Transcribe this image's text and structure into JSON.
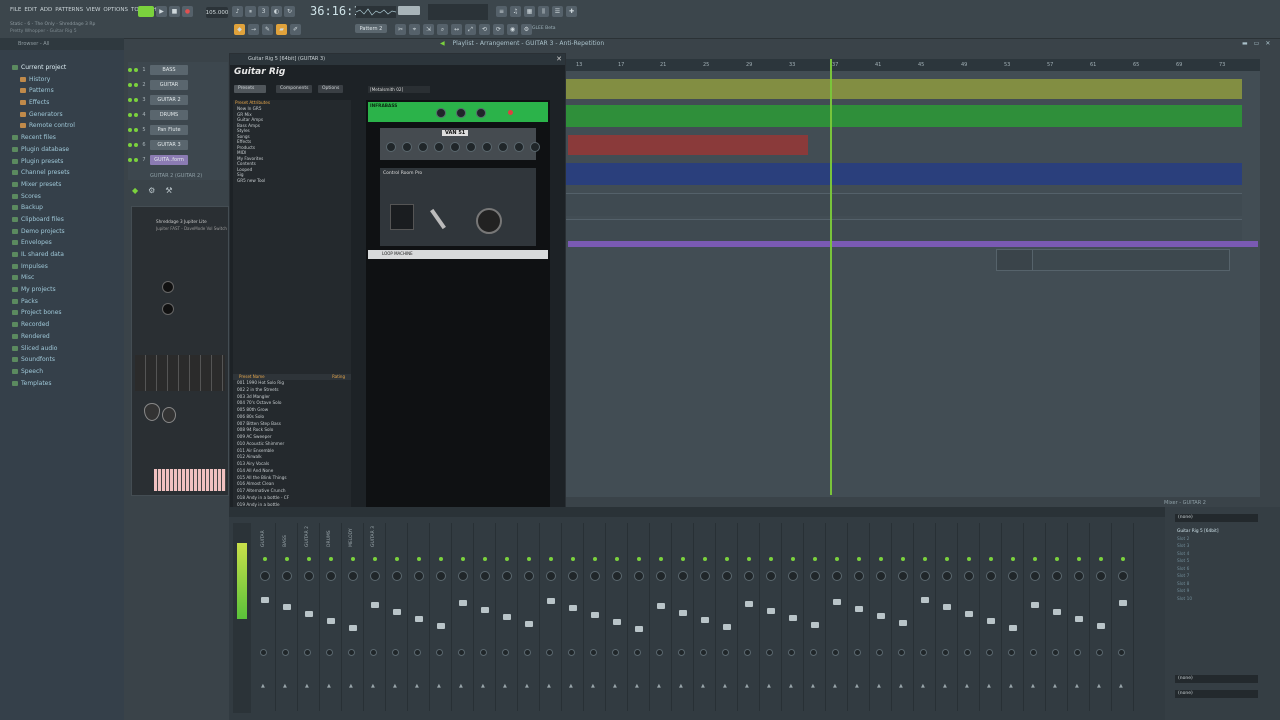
{
  "menu": [
    "FILE",
    "EDIT",
    "ADD",
    "PATTERNS",
    "VIEW",
    "OPTIONS",
    "TOOLS",
    "HELP"
  ],
  "song_info": "Static - 6 - The Only - Shreddage 3 Rp",
  "hint": "Pretty Whopper - Guitar Rig 5",
  "transport": {
    "time": "36:16:11",
    "bpm": "105.000",
    "pattern": "Pattern 2",
    "plugin_label": "GLEE Beta"
  },
  "browser": {
    "header": "Browser - All",
    "items": [
      {
        "label": "Current project",
        "level": 0,
        "color": "#cfe6ee"
      },
      {
        "label": "History",
        "level": 1
      },
      {
        "label": "Patterns",
        "level": 1
      },
      {
        "label": "Effects",
        "level": 1
      },
      {
        "label": "Generators",
        "level": 1
      },
      {
        "label": "Remote control",
        "level": 1
      },
      {
        "label": "Recent files",
        "level": 0
      },
      {
        "label": "Plugin database",
        "level": 0
      },
      {
        "label": "Plugin presets",
        "level": 0
      },
      {
        "label": "Channel presets",
        "level": 0
      },
      {
        "label": "Mixer presets",
        "level": 0
      },
      {
        "label": "Scores",
        "level": 0
      },
      {
        "label": "Backup",
        "level": 0
      },
      {
        "label": "Clipboard files",
        "level": 0
      },
      {
        "label": "Demo projects",
        "level": 0
      },
      {
        "label": "Envelopes",
        "level": 0
      },
      {
        "label": "IL shared data",
        "level": 0
      },
      {
        "label": "Impulses",
        "level": 0
      },
      {
        "label": "Misc",
        "level": 0
      },
      {
        "label": "My projects",
        "level": 0
      },
      {
        "label": "Packs",
        "level": 0
      },
      {
        "label": "Project bones",
        "level": 0
      },
      {
        "label": "Recorded",
        "level": 0
      },
      {
        "label": "Rendered",
        "level": 0
      },
      {
        "label": "Sliced audio",
        "level": 0
      },
      {
        "label": "Soundfonts",
        "level": 0
      },
      {
        "label": "Speech",
        "level": 0
      },
      {
        "label": "Templates",
        "level": 0
      }
    ]
  },
  "channel_rack": {
    "channels": [
      {
        "num": "1",
        "name": "BASS"
      },
      {
        "num": "2",
        "name": "GUITAR"
      },
      {
        "num": "3",
        "name": "GUITAR 2"
      },
      {
        "num": "4",
        "name": "DRUMS"
      },
      {
        "num": "5",
        "name": "Pan Flute"
      },
      {
        "num": "6",
        "name": "GUITAR 3"
      },
      {
        "num": "7",
        "name": "GUITA..form",
        "selected": true
      }
    ],
    "plugin_name": "GUITAR 2 (GUITAR 2)",
    "instrument_name": "Shreddage 3 Jupiter Lite",
    "instrument_preset": "Jupiter FAST - DaveMode Vol Switch"
  },
  "guitar_rig": {
    "window_title": "Guitar Rig 5 [64bit] (GUITAR 3)",
    "logo": "Guitar Rig",
    "tabs": [
      "Presets",
      "Components",
      "Options"
    ],
    "preset_header": "Preset Attributes",
    "attributes": [
      "New In GR5",
      "GR Mix",
      "Guitar Amps",
      "Bass Amps",
      "Styles",
      "Songs",
      "Effects",
      "Products",
      "MIDI",
      "My Favorites",
      "Contents",
      "Looped",
      "Sig",
      "GR5 new Tool"
    ],
    "list_header": [
      "Preset Name",
      "Rating"
    ],
    "presets": [
      "001 1990 Hot Solo Rig",
      "002 2 in the Streets",
      "003 3d Mangler",
      "004 70's Octave Solo",
      "005 80th Grow",
      "006 80s Solo",
      "007 Bitten Step Bass",
      "008 94 Rock Solo",
      "009 AC Sweeper",
      "010 Acoustic Shimmer",
      "011 Air Ensemble",
      "012 Airwalk",
      "013 Airy Vocals",
      "014 All And None",
      "015 All the Blink Things",
      "016 Almost Clean",
      "017 Alternative Crunch",
      "018 Andy in a bottle - CF",
      "019 Andy in a bottle",
      "020 Area 51",
      "021 Arpeggio Delays",
      "022 Alma Git",
      "023 Auto Rhythm",
      "024 Autofilter Bass",
      "025 Bassic Uda (Hill)",
      "026 Basic Jazz",
      "027 Bass Rig",
      "028 Bored Die Flasche"
    ],
    "rack_preset": "[Metalsmith 02]",
    "amp_name": "VAN 51",
    "module_headers": [
      "INFRABASS",
      "Control Room Pro",
      "LOOP MACHINE"
    ]
  },
  "playlist": {
    "breadcrumb": "Playlist - Arrangement - GUITAR 3 - Anti-Repetition",
    "bars": [
      "13",
      "17",
      "21",
      "25",
      "29",
      "33",
      "37",
      "41",
      "45",
      "49",
      "53",
      "57",
      "61",
      "65",
      "69",
      "73"
    ]
  },
  "mixer": {
    "title": "Mixer - GUITAR 2",
    "tracks": [
      "GUITAR",
      "BASS",
      "GUITAR 2",
      "DRUMS",
      "MELODY",
      "GUITAR 3"
    ],
    "fx_header": "(none)",
    "fx_slots": [
      "Guitar Rig 5 [64bit]",
      "Slot 2",
      "Slot 3",
      "Slot 4",
      "Slot 5",
      "Slot 6",
      "Slot 7",
      "Slot 8",
      "Slot 9",
      "Slot 10"
    ],
    "fx_footer": [
      "(none)",
      "(none)"
    ]
  },
  "colors": {
    "accent_green": "#79c43b",
    "selected_channel": "#8b7bb3",
    "guitar_clip": "#8d9a3f",
    "guitar2_clip": "#2f8f3a",
    "bass_clip": "#8a3a3a",
    "drums_clip": "#2a3f7c",
    "melody_clip": "#7a5ab3"
  }
}
